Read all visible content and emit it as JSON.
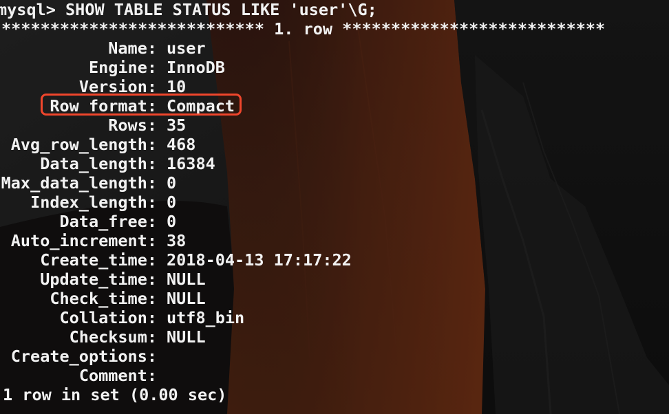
{
  "terminal": {
    "prompt_line": "mysql> SHOW TABLE STATUS LIKE 'user'\\G;",
    "row_header": "*************************** 1. row ***************************",
    "fields": [
      {
        "label": "Name:",
        "value": "user"
      },
      {
        "label": "Engine:",
        "value": "InnoDB"
      },
      {
        "label": "Version:",
        "value": "10"
      },
      {
        "label": "Row_format:",
        "value": "Compact"
      },
      {
        "label": "Rows:",
        "value": "35"
      },
      {
        "label": "Avg_row_length:",
        "value": "468"
      },
      {
        "label": "Data_length:",
        "value": "16384"
      },
      {
        "label": "Max_data_length:",
        "value": "0"
      },
      {
        "label": "Index_length:",
        "value": "0"
      },
      {
        "label": "Data_free:",
        "value": "0"
      },
      {
        "label": "Auto_increment:",
        "value": "38"
      },
      {
        "label": "Create_time:",
        "value": "2018-04-13 17:17:22"
      },
      {
        "label": "Update_time:",
        "value": "NULL"
      },
      {
        "label": "Check_time:",
        "value": "NULL"
      },
      {
        "label": "Collation:",
        "value": "utf8_bin"
      },
      {
        "label": "Checksum:",
        "value": "NULL"
      },
      {
        "label": "Create_options:",
        "value": ""
      },
      {
        "label": "Comment:",
        "value": ""
      }
    ],
    "footer_line": "1 row in set (0.00 sec)",
    "highlight_color": "#f0462c",
    "text_color": "#f2f2f2"
  }
}
